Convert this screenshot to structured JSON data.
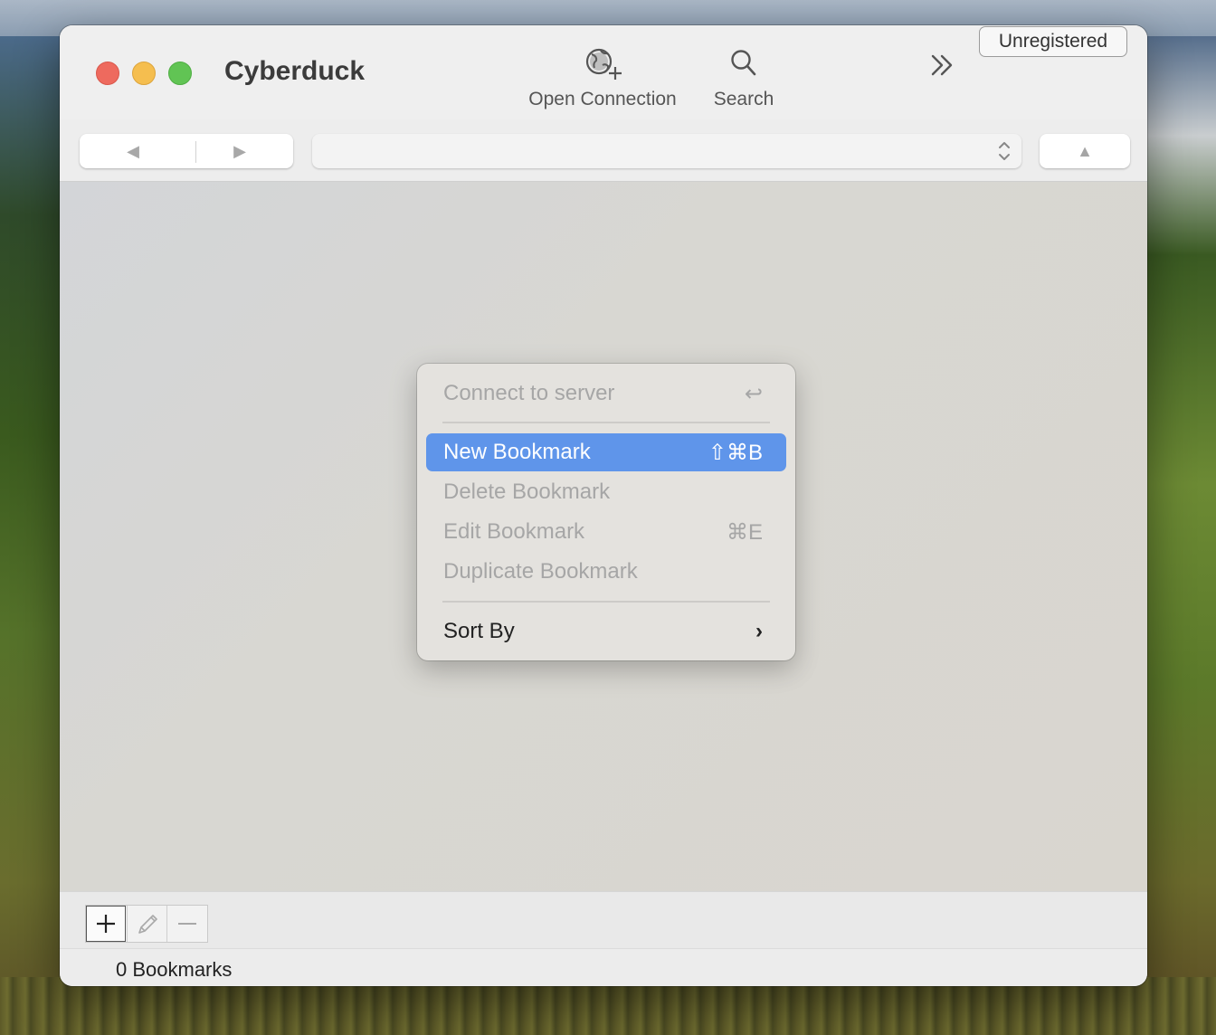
{
  "window": {
    "title": "Cyberduck"
  },
  "toolbar": {
    "open_connection_label": "Open Connection",
    "search_label": "Search",
    "overflow_icon": "chevron-double-right-icon",
    "unregistered_label": "Unregistered"
  },
  "navigation": {
    "back_glyph": "◀",
    "forward_glyph": "▶",
    "path_value": "",
    "up_glyph": "▲"
  },
  "context_menu": {
    "items": [
      {
        "label": "Connect to server",
        "shortcut": "↩",
        "enabled": false
      },
      {
        "label": "New Bookmark",
        "shortcut": "⇧⌘B",
        "enabled": true,
        "highlighted": true
      },
      {
        "label": "Delete Bookmark",
        "shortcut": "",
        "enabled": false
      },
      {
        "label": "Edit Bookmark",
        "shortcut": "⌘E",
        "enabled": false
      },
      {
        "label": "Duplicate Bookmark",
        "shortcut": "",
        "enabled": false
      },
      {
        "label": "Sort By",
        "shortcut": "›",
        "enabled": true,
        "submenu": true
      }
    ]
  },
  "bottom_bar": {
    "add_icon": "plus-icon",
    "edit_icon": "pencil-icon",
    "remove_icon": "minus-icon"
  },
  "status": {
    "text": "0 Bookmarks"
  },
  "colors": {
    "highlight": "#5f95ea",
    "close": "#ee6a5e",
    "minimize": "#f5be4f",
    "zoom": "#61c454"
  }
}
